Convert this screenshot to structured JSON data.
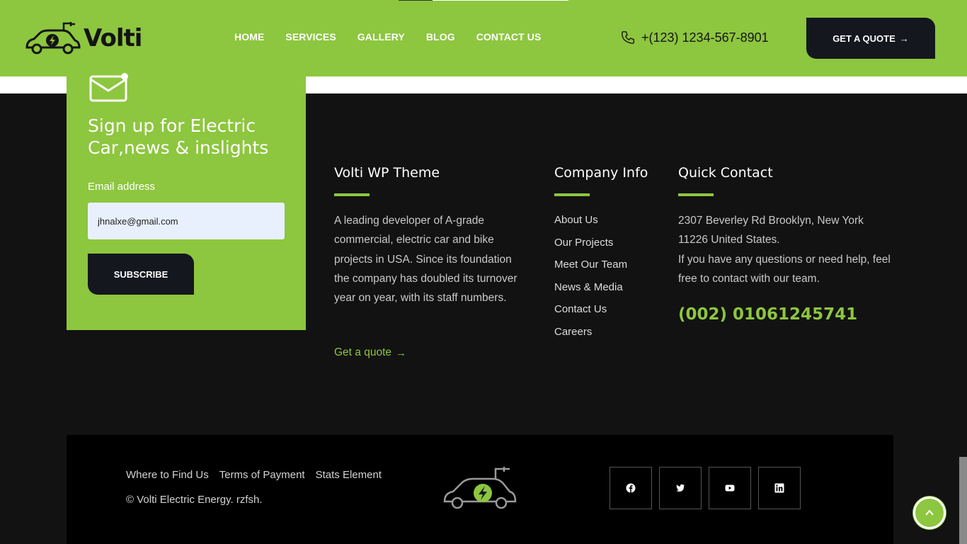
{
  "brand": {
    "name": "Volti",
    "accent": "#8dc63f",
    "dark": "#15171f"
  },
  "header": {
    "nav": [
      "HOME",
      "SERVICES",
      "GALLERY",
      "BLOG",
      "CONTACT US"
    ],
    "phone": "+(123) 1234-567-8901",
    "quote_label": "GET A QUOTE"
  },
  "signup": {
    "title": "Sign up for Electric Car,news & inslights",
    "email_label": "Email address",
    "email_value": "jhnalxe@gmail.com",
    "subscribe_label": "SUBSCRIBE"
  },
  "about": {
    "title": "Volti WP Theme",
    "text": "A leading developer of A-grade commercial, electric car and bike projects in USA. Since its foundation the company has doubled its turnover year on year, with its staff numbers.",
    "link": "Get a quote"
  },
  "company": {
    "title": "Company Info",
    "items": [
      "About Us",
      "Our Projects",
      "Meet Our Team",
      "News & Media",
      "Contact Us",
      "Careers"
    ]
  },
  "contact": {
    "title": "Quick Contact",
    "address": "2307 Beverley Rd Brooklyn, New York 11226 United States.",
    "help": "If you have any questions or need help, feel free to contact with our team.",
    "phone": "(002) 01061245741"
  },
  "bottom": {
    "links": [
      "Where to Find Us",
      "Terms of Payment",
      "Stats Element"
    ],
    "copyright": "© Volti Electric Energy. rzfsh."
  },
  "social": [
    "facebook-icon",
    "twitter-icon",
    "youtube-icon",
    "linkedin-icon"
  ]
}
